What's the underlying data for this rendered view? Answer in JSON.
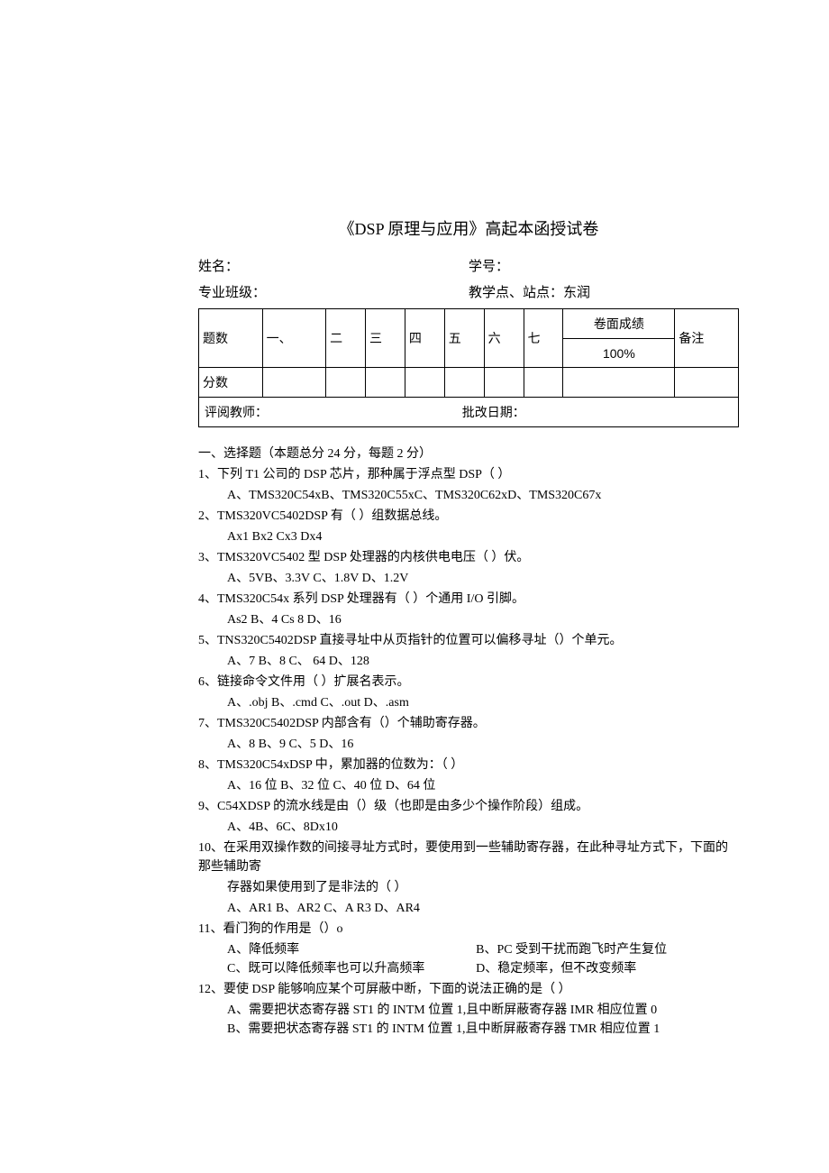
{
  "title": "《DSP 原理与应用》高起本函授试卷",
  "info": {
    "name_label": "姓名：",
    "id_label": "学号：",
    "class_label": "专业班级：",
    "site_label": "教学点、站点：东润"
  },
  "score_table": {
    "headers": [
      "题数",
      "一、",
      "二",
      "三",
      "四",
      "五",
      "六",
      "七",
      "卷面成绩",
      "备注"
    ],
    "percent": "100%",
    "score_label": "分数",
    "reviewer_label": "评阅教师：",
    "date_label": "批改日期："
  },
  "section1": {
    "title": "一、选择题（本题总分 24 分，每题 2 分）",
    "q1": "1、下列 T1 公司的 DSP 芯片，那种属于浮点型 DSP（                  ）",
    "q1_opts": "A、TMS320C54xB、TMS320C55xC、TMS320C62xD、TMS320C67x",
    "q2": "2、TMS320VC5402DSP 有（             ）组数据总线。",
    "q2_opts": "Ax1         Bx2            Cx3         Dx4",
    "q3": "3、TMS320VC5402 型 DSP 处理器的内核供电电压（            ）伏。",
    "q3_opts": "A、5VB、3.3V                C、1.8V         D、1.2V",
    "q4": "4、TMS320C54x 系列 DSP 处理器有（           ）个通用 I/O 引脚。",
    "q4_opts": "As2          B、4     Cs    8          D、16",
    "q5": "5、TNS320C5402DSP 直接寻址中从页指针的位置可以偏移寻址（）个单元。",
    "q5_opts": "A、7        B、8     C、   64         D、128",
    "q6": "6、链接命令文件用（        ）扩展名表示。",
    "q6_opts": "A、.obj    B、.cmd    C、.out        D、.asm",
    "q7": "7、TMS320C5402DSP 内部含有（）个辅助寄存器。",
    "q7_opts": "A、8              B、9           C、5              D、16",
    "q8": "8、TMS320C54xDSP 中，累加器的位数为：（          ）",
    "q8_opts": "A、16 位 B、32 位                C、40 位         D、64 位",
    "q9": "9、C54XDSP 的流水线是由（）级（也即是由多少个操作阶段）组成。",
    "q9_opts": "A、4B、6C、8Dx10",
    "q10": "10、在采用双操作数的间接寻址方式时，要使用到一些辅助寄存器，在此种寻址方式下，下面的那些辅助寄",
    "q10_cont": "存器如果使用到了是非法的（              ）",
    "q10_opts": "A、AR1             B、AR2         C、A R3            D、AR4",
    "q11": "11、看门狗的作用是（）o",
    "q11_a": "A、降低频率",
    "q11_b": "B、PC 受到干扰而跑飞时产生复位",
    "q11_c": "C、既可以降低频率也可以升高频率",
    "q11_d": "D、稳定频率，但不改变频率",
    "q12": "12、要使 DSP 能够响应某个可屏蔽中断，下面的说法正确的是（                   ）",
    "q12_a": "A、需要把状态寄存器 ST1 的 INTM 位置 1,且中断屏蔽寄存器 IMR 相应位置 0",
    "q12_b": "B、需要把状态寄存器 ST1 的 INTM 位置 1,且中断屏蔽寄存器 TMR 相应位置 1"
  }
}
